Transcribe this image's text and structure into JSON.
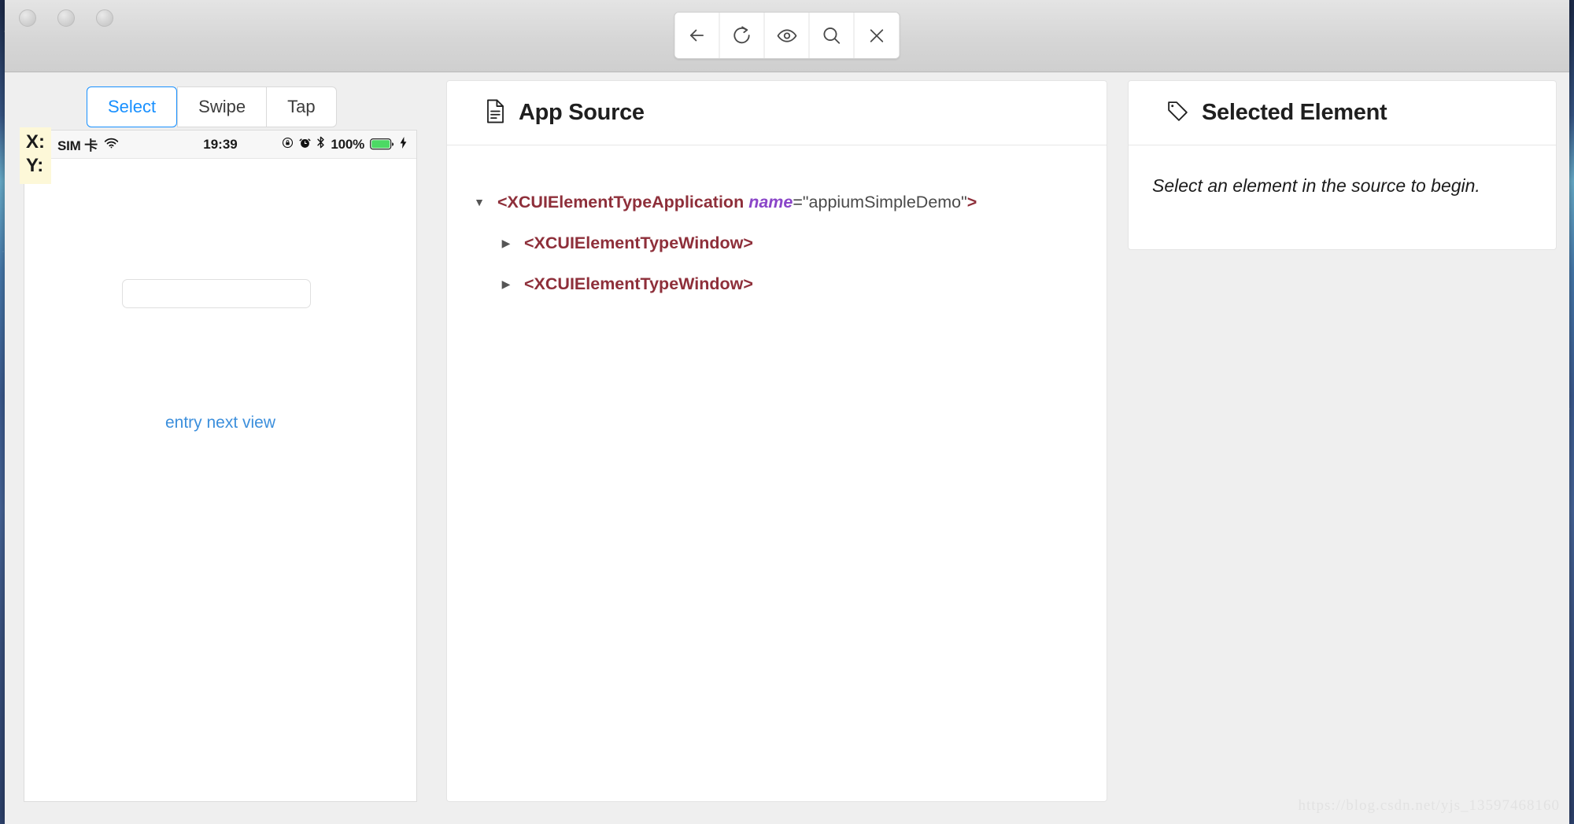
{
  "window": {
    "traffic_lights": [
      "close",
      "minimize",
      "zoom"
    ]
  },
  "toolbar": {
    "buttons": [
      {
        "name": "back-button",
        "icon": "arrow-left-icon",
        "label": "Back"
      },
      {
        "name": "refresh-button",
        "icon": "refresh-icon",
        "label": "Refresh Source"
      },
      {
        "name": "inspect-button",
        "icon": "eye-icon",
        "label": "Inspect"
      },
      {
        "name": "search-button",
        "icon": "search-icon",
        "label": "Search for Element"
      },
      {
        "name": "close-button",
        "icon": "close-icon",
        "label": "Quit Session"
      }
    ]
  },
  "device_panel": {
    "tabs": [
      {
        "label": "Select",
        "active": true
      },
      {
        "label": "Swipe",
        "active": false
      },
      {
        "label": "Tap",
        "active": false
      }
    ],
    "coordinates": {
      "x_label": "X:",
      "y_label": "Y:",
      "x_value": "",
      "y_value": ""
    },
    "status_bar": {
      "carrier": "SIM 卡",
      "wifi_icon": "wifi-icon",
      "time": "19:39",
      "rotation_lock_icon": "rotation-lock-icon",
      "alarm_icon": "alarm-clock-icon",
      "bluetooth_icon": "bluetooth-icon",
      "battery_percent": "100%",
      "battery_icon": "battery-full-icon",
      "charging_icon": "lightning-bolt-icon"
    },
    "screen": {
      "text_field_value": "",
      "text_field_placeholder": "",
      "link_label": "entry next view"
    }
  },
  "source_panel": {
    "icon": "document-icon",
    "title": "App Source",
    "tree": [
      {
        "indent": 0,
        "caret": "▼",
        "expanded": true,
        "tag_open": "<XCUIElementTypeApplication",
        "attr_name": "name",
        "attr_eq": "=",
        "attr_value": "\"appiumSimpleDemo\"",
        "tag_close": ">"
      },
      {
        "indent": 1,
        "caret": "▶",
        "expanded": false,
        "tag_open": "<XCUIElementTypeWindow",
        "attr_name": "",
        "attr_eq": "",
        "attr_value": "",
        "tag_close": ">"
      },
      {
        "indent": 1,
        "caret": "▶",
        "expanded": false,
        "tag_open": "<XCUIElementTypeWindow",
        "attr_name": "",
        "attr_eq": "",
        "attr_value": "",
        "tag_close": ">"
      }
    ]
  },
  "selected_panel": {
    "icon": "tag-icon",
    "title": "Selected Element",
    "empty_hint": "Select an element in the source to begin."
  },
  "watermark": "https://blog.csdn.net/yjs_13597468160",
  "colors": {
    "accent": "#1890ff",
    "link": "#3c8fdc",
    "tag": "#8e2f3a",
    "attr": "#8a45c8",
    "coord_badge_bg": "#fdf8d8",
    "battery_green": "#4cd964",
    "window_bg": "#efefef",
    "titlebar_bg": "#d6d6d6"
  }
}
